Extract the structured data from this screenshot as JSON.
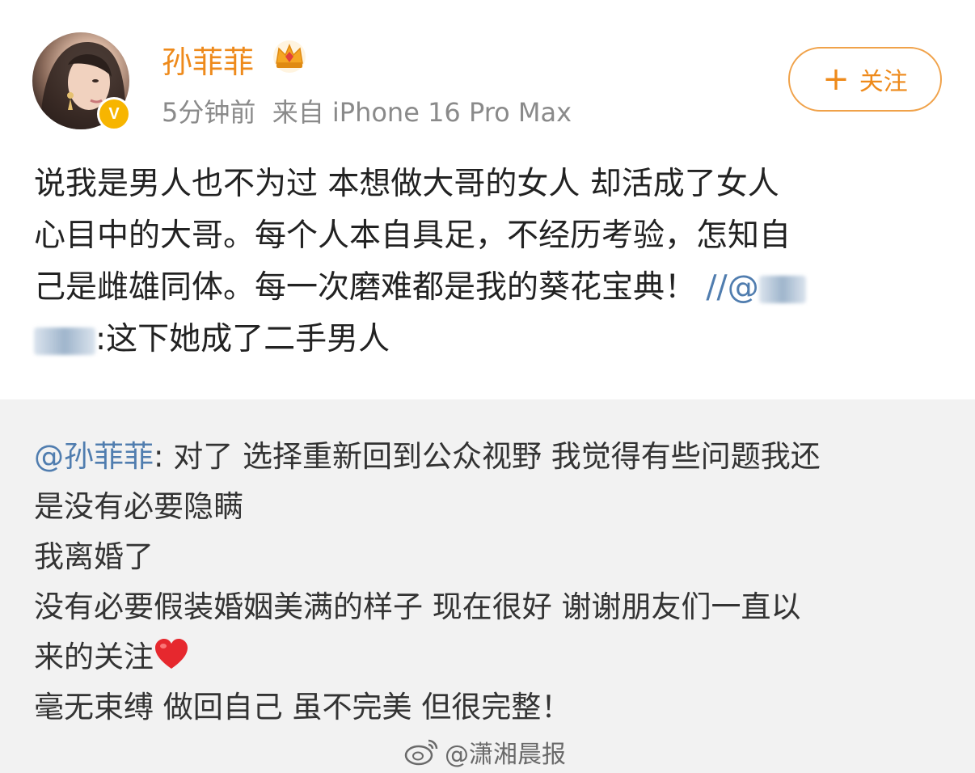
{
  "header": {
    "username": "孙菲菲",
    "meta": "5分钟前  来自 iPhone 16 Pro Max",
    "follow_label": "关注",
    "verified_glyph": "V"
  },
  "post": {
    "line1": "说我是男人也不为过 本想做大哥的女人 却活成了女人",
    "line2": "心目中的大哥。每个人本自具足，不经历考验，怎知自",
    "line3": "己是雌雄同体。每一次磨难都是我的葵花宝典！",
    "line3_mention": "//@",
    "line4": ":这下她成了二手男人"
  },
  "repost": {
    "mention": "@孙菲菲",
    "line1_rest": ": 对了 选择重新回到公众视野 我觉得有些问题我还",
    "line2": "是没有必要隐瞒",
    "line3": "我离婚了",
    "line4": "没有必要假装婚姻美满的样子 现在很好 谢谢朋友们一直以",
    "line5": "来的关注",
    "line6": "毫无束缚 做回自己 虽不完美 但很完整！"
  },
  "watermark": {
    "text": "@潇湘晨报"
  },
  "colors": {
    "username": "#ee8a1b",
    "link": "#507daf",
    "repost_bg": "#f2f2f2",
    "verified": "#f7b500"
  },
  "icons": [
    "crown-icon",
    "verified-icon",
    "plus-icon",
    "heart-icon",
    "weibo-icon"
  ]
}
